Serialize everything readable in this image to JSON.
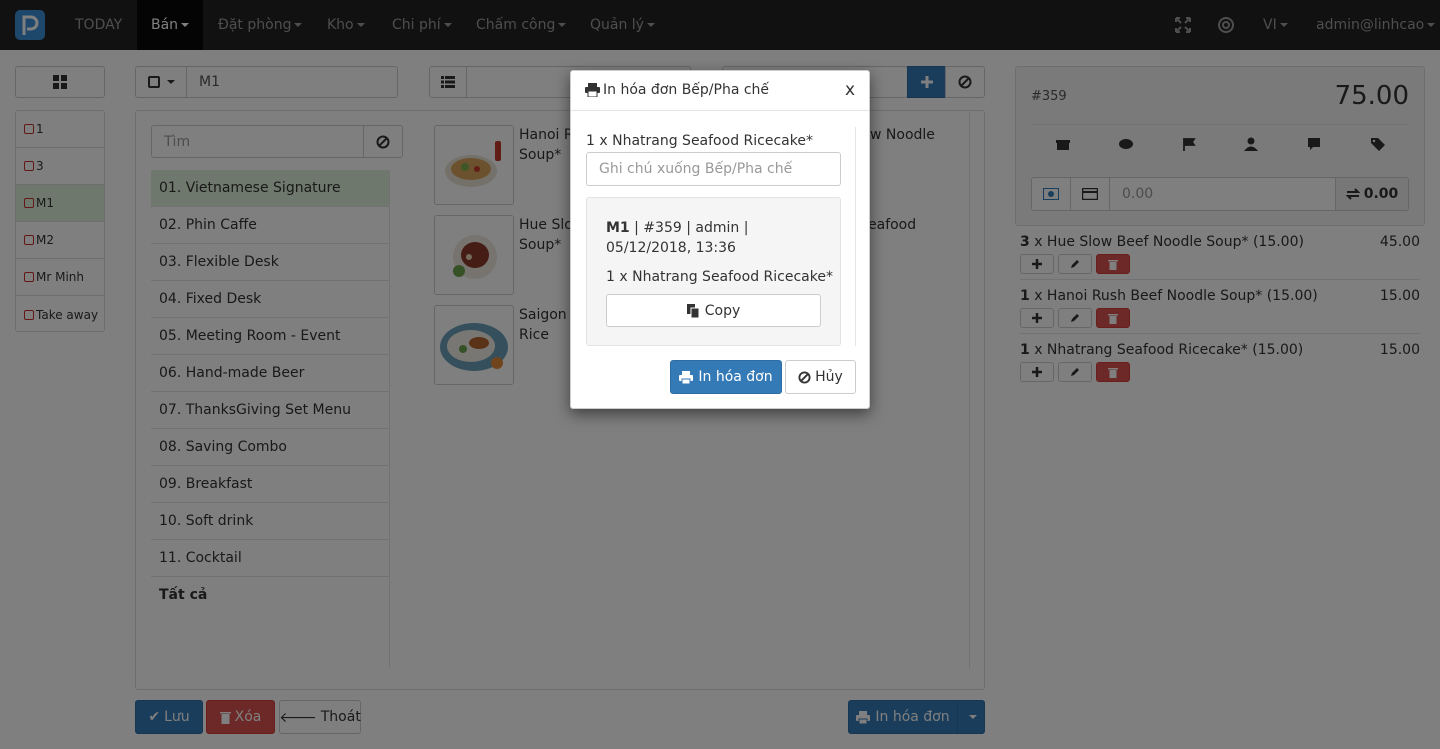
{
  "navbar": {
    "today": "TODAY",
    "menu": [
      "Bán",
      "Đặt phòng",
      "Kho",
      "Chi phí",
      "Chấm công",
      "Quản lý"
    ],
    "language": "VI",
    "user": "admin@linhcao"
  },
  "toolbar": {
    "table_value": "M1",
    "search_placeholder": "Tìm"
  },
  "tables": [
    "1",
    "3",
    "M1",
    "M2",
    "Mr Minh",
    "Take away"
  ],
  "categories": [
    "01. Vietnamese Signature",
    "02. Phin Caffe",
    "03. Flexible Desk",
    "04. Fixed Desk",
    "05. Meeting Room - Event",
    "06. Hand-made Beer",
    "07. ThanksGiving Set Menu",
    "08. Saving Combo",
    "09. Breakfast",
    "10. Soft drink",
    "11. Cocktail",
    "Tất cả"
  ],
  "products": [
    {
      "name_a": "Hanoi R",
      "name_b": "Soup*",
      "name_c": "w Noodle"
    },
    {
      "name_a": "Hue Slo",
      "name_b": "Soup*",
      "name_c": "eafood"
    },
    {
      "name_a": "Saigon I",
      "name_b": "Rice"
    }
  ],
  "order": {
    "number": "#359",
    "total": "75.00",
    "payment_input": "0.00",
    "change": "0.00",
    "lines": [
      {
        "qty": "3",
        "text": " x Hue Slow Beef Noodle Soup* (15.00)",
        "price": "45.00"
      },
      {
        "qty": "1",
        "text": " x Hanoi Rush Beef Noodle Soup* (15.00)",
        "price": "15.00"
      },
      {
        "qty": "1",
        "text": " x Nhatrang Seafood Ricecake* (15.00)",
        "price": "15.00"
      }
    ]
  },
  "footer": {
    "save": "Lưu",
    "delete": "Xóa",
    "exit": "Thoát",
    "print": "In hóa đơn"
  },
  "modal": {
    "title": "In hóa đơn Bếp/Pha chế",
    "close": "x",
    "item_label": "1 x  Nhatrang Seafood Ricecake*",
    "note_placeholder": "Ghi chú xuống Bếp/Pha chế",
    "preview_table": "M1",
    "preview_meta": " | #359 | admin | 05/12/2018, 13:36",
    "preview_item": "1 x Nhatrang Seafood Ricecake*",
    "copy": "Copy",
    "print": "In hóa đơn",
    "cancel": "Hủy"
  },
  "colors": {
    "primary": "#337ab7",
    "danger": "#d9534f",
    "navbar": "#222222",
    "selected_row": "#dff0d8"
  }
}
